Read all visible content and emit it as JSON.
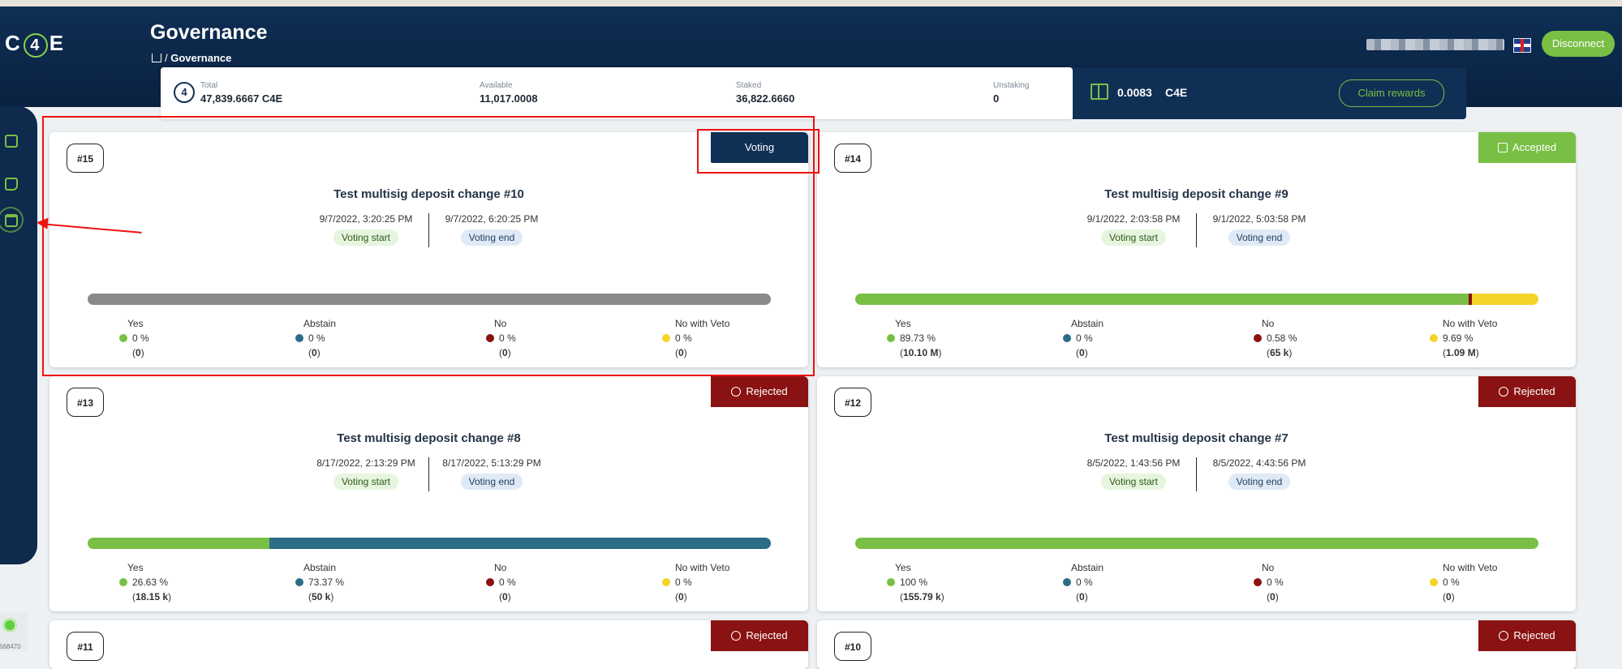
{
  "app": {
    "logo": "C4E"
  },
  "header": {
    "title": "Governance",
    "breadcrumb_current": "Governance",
    "disconnect_label": "Disconnect"
  },
  "balances": {
    "total_label": "Total",
    "total_value": "47,839.6667 C4E",
    "available_label": "Available",
    "available_value": "11,017.0008",
    "staked_label": "Staked",
    "staked_value": "36,822.6660",
    "unstaking_label": "Unstaking",
    "unstaking_value": "0"
  },
  "rewards": {
    "value": "0.0083",
    "unit": "C4E",
    "claim_label": "Claim rewards"
  },
  "status_widget": {
    "text": "668470"
  },
  "colors": {
    "yes": "#79bf45",
    "abstain": "#2b6d85",
    "no": "#8a1212",
    "veto": "#f5d42a",
    "voting": "#102f55",
    "brand": "#0f2f55"
  },
  "legend_labels": {
    "yes": "Yes",
    "abstain": "Abstain",
    "no": "No",
    "veto": "No with Veto"
  },
  "date_labels": {
    "start": "Voting start",
    "end": "Voting end"
  },
  "proposals": [
    {
      "id": "#15",
      "status": "Voting",
      "title": "Test multisig deposit change #10",
      "start": "9/7/2022, 3:20:25 PM",
      "end": "9/7/2022, 6:20:25 PM",
      "bar": {
        "yes": 0,
        "abstain": 0,
        "no": 0,
        "veto": 0
      },
      "yes": {
        "pct": "0 %",
        "count": "0"
      },
      "abstain": {
        "pct": "0 %",
        "count": "0"
      },
      "no": {
        "pct": "0 %",
        "count": "0"
      },
      "veto": {
        "pct": "0 %",
        "count": "0"
      }
    },
    {
      "id": "#14",
      "status": "Accepted",
      "title": "Test multisig deposit change #9",
      "start": "9/1/2022, 2:03:58 PM",
      "end": "9/1/2022, 5:03:58 PM",
      "bar": {
        "yes": 89.73,
        "abstain": 0,
        "no": 0.58,
        "veto": 9.69
      },
      "yes": {
        "pct": "89.73 %",
        "count": "10.10 M"
      },
      "abstain": {
        "pct": "0 %",
        "count": "0"
      },
      "no": {
        "pct": "0.58 %",
        "count": "65 k"
      },
      "veto": {
        "pct": "9.69 %",
        "count": "1.09 M"
      }
    },
    {
      "id": "#13",
      "status": "Rejected",
      "title": "Test multisig deposit change #8",
      "start": "8/17/2022, 2:13:29 PM",
      "end": "8/17/2022, 5:13:29 PM",
      "bar": {
        "yes": 26.63,
        "abstain": 73.37,
        "no": 0,
        "veto": 0
      },
      "yes": {
        "pct": "26.63 %",
        "count": "18.15 k"
      },
      "abstain": {
        "pct": "73.37 %",
        "count": "50 k"
      },
      "no": {
        "pct": "0 %",
        "count": "0"
      },
      "veto": {
        "pct": "0 %",
        "count": "0"
      }
    },
    {
      "id": "#12",
      "status": "Rejected",
      "title": "Test multisig deposit change #7",
      "start": "8/5/2022, 1:43:56 PM",
      "end": "8/5/2022, 4:43:56 PM",
      "bar": {
        "yes": 100,
        "abstain": 0,
        "no": 0,
        "veto": 0
      },
      "yes": {
        "pct": "100 %",
        "count": "155.79 k"
      },
      "abstain": {
        "pct": "0 %",
        "count": "0"
      },
      "no": {
        "pct": "0 %",
        "count": "0"
      },
      "veto": {
        "pct": "0 %",
        "count": "0"
      }
    },
    {
      "id": "#11",
      "status": "Rejected"
    },
    {
      "id": "#10",
      "status": "Rejected"
    }
  ]
}
